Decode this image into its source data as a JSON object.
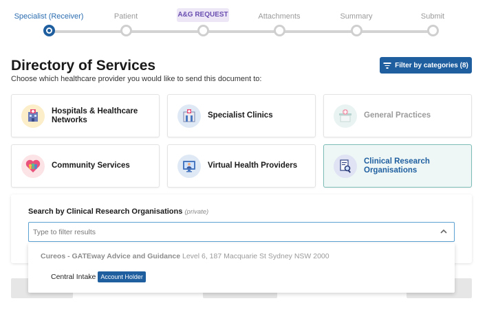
{
  "stepper": {
    "steps": [
      {
        "label": "Specialist (Receiver)",
        "state": "active"
      },
      {
        "label": "Patient",
        "state": "upcoming"
      },
      {
        "label": "A&G REQUEST",
        "state": "upcoming"
      },
      {
        "label": "Attachments",
        "state": "upcoming"
      },
      {
        "label": "Summary",
        "state": "upcoming"
      },
      {
        "label": "Submit",
        "state": "upcoming"
      }
    ]
  },
  "header": {
    "title": "Directory of Services",
    "subtitle": "Choose which healthcare provider you would like to send this document to:",
    "filter_label": "Filter by categories (8)"
  },
  "categories": [
    {
      "label": "Hospitals & Healthcare Networks",
      "icon": "hospital-icon",
      "state": "default"
    },
    {
      "label": "Specialist Clinics",
      "icon": "specialist-clinic-icon",
      "state": "default"
    },
    {
      "label": "General Practices",
      "icon": "general-practice-icon",
      "state": "disabled"
    },
    {
      "label": "Community Services",
      "icon": "community-icon",
      "state": "default"
    },
    {
      "label": "Virtual Health Providers",
      "icon": "virtual-health-icon",
      "state": "default"
    },
    {
      "label": "Clinical Research Organisations",
      "icon": "clinical-research-icon",
      "state": "selected"
    }
  ],
  "search": {
    "title": "Search by Clinical Research Organisations",
    "private_note": "(private)",
    "placeholder": "Type to filter results",
    "value": ""
  },
  "dropdown": {
    "group_name": "Cureos - GATEway Advice and Guidance",
    "group_address": "Level 6, 187 Macquarie St Sydney NSW 2000",
    "items": [
      {
        "label": "Central Intake",
        "badge": "Account Holder"
      }
    ]
  },
  "colors": {
    "primary": "#1f5fa0",
    "selected_card_bg": "#eef7f6",
    "pill_bg": "#ece6f7"
  }
}
